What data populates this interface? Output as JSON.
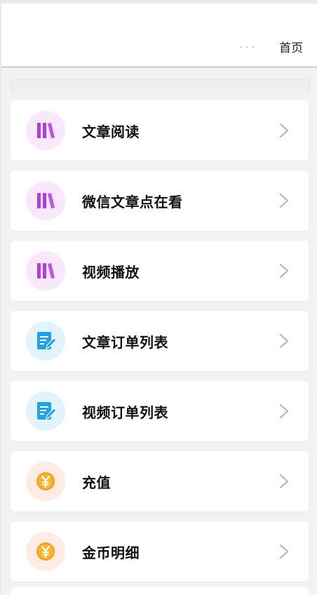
{
  "header": {
    "home_label": "首页"
  },
  "colors": {
    "purple_bg": "#f9e8fb",
    "purple": "#b23ce0",
    "blue_bg": "#e1f3fb",
    "blue": "#1fa2e8",
    "orange_bg": "#fdebe4",
    "orange": "#f7a21b",
    "chevron": "#bdbdbd"
  },
  "menu": {
    "items": [
      {
        "label": "文章阅读",
        "icon": "books-icon"
      },
      {
        "label": "微信文章点在看",
        "icon": "books-icon"
      },
      {
        "label": "视频播放",
        "icon": "books-icon"
      },
      {
        "label": "文章订单列表",
        "icon": "edit-document-icon"
      },
      {
        "label": "视频订单列表",
        "icon": "edit-document-icon"
      },
      {
        "label": "充值",
        "icon": "yen-coin-icon"
      },
      {
        "label": "金币明细",
        "icon": "yen-coin-icon"
      }
    ]
  }
}
